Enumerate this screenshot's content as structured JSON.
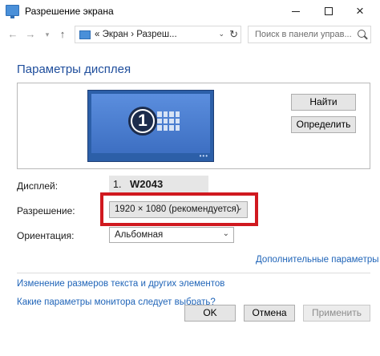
{
  "window": {
    "title": "Разрешение экрана",
    "icon": "display-settings-icon",
    "controls": {
      "minimize": "minimize-icon",
      "maximize": "maximize-icon",
      "close": "×"
    }
  },
  "navbar": {
    "back": "←",
    "forward": "→",
    "history_dropdown": "▾",
    "up": "↑",
    "address": "«  Экран  ›  Разреш...",
    "address_dropdown": "⌄",
    "refresh": "↻",
    "search_placeholder": "Поиск в панели управ..."
  },
  "page": {
    "heading": "Параметры дисплея"
  },
  "preview": {
    "monitor_number": "1",
    "buttons": {
      "identify": "Найти",
      "detect": "Определить"
    }
  },
  "settings": {
    "display_label": "Дисплей:",
    "display_number": "1.",
    "display_name": "W2043",
    "resolution_label": "Разрешение:",
    "resolution_value": "1920 × 1080 (рекомендуется)",
    "orientation_label": "Ориентация:",
    "orientation_value": "Альбомная",
    "dropdown_arrow": "⌄"
  },
  "links": {
    "advanced": "Дополнительные параметры",
    "text_size": "Изменение размеров текста и других элементов",
    "which_settings": "Какие параметры монитора следует выбрать?"
  },
  "footer": {
    "ok": "OK",
    "cancel": "Отмена",
    "apply": "Применить"
  },
  "colors": {
    "heading": "#1f4e9c",
    "link": "#1f64b8",
    "highlight": "#d0191f",
    "monitor": "#2c5fa8"
  }
}
